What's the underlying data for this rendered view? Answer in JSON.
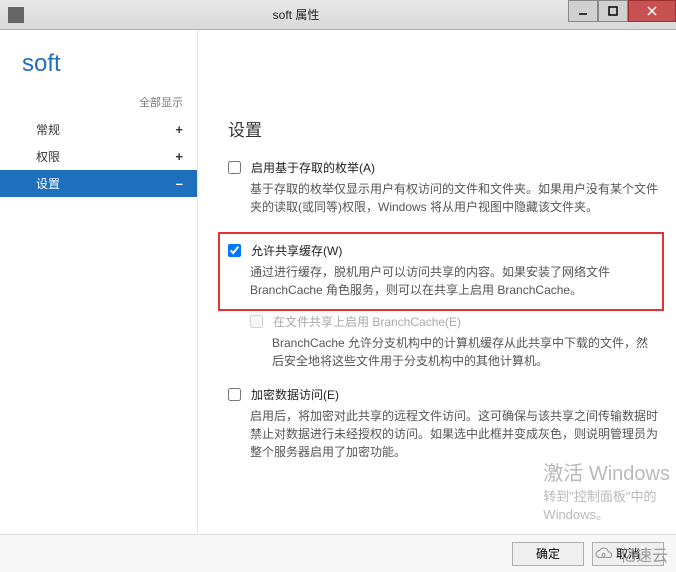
{
  "titlebar": {
    "title": "soft 属性"
  },
  "sidebar": {
    "app_title": "soft",
    "show_all": "全部显示",
    "items": [
      {
        "label": "常规",
        "symbol": "+"
      },
      {
        "label": "权限",
        "symbol": "+"
      },
      {
        "label": "设置",
        "symbol": "–"
      }
    ]
  },
  "content": {
    "section_title": "设置",
    "settings": [
      {
        "label": "启用基于存取的枚举(A)",
        "desc": "基于存取的枚举仅显示用户有权访问的文件和文件夹。如果用户没有某个文件夹的读取(或同等)权限，Windows 将从用户视图中隐藏该文件夹。"
      },
      {
        "label": "允许共享缓存(W)",
        "desc": "通过进行缓存，脱机用户可以访问共享的内容。如果安装了网络文件 BranchCache 角色服务，则可以在共享上启用 BranchCache。"
      },
      {
        "label": "在文件共享上启用 BranchCache(E)",
        "desc": "BranchCache 允许分支机构中的计算机缓存从此共享中下载的文件，然后安全地将这些文件用于分支机构中的其他计算机。"
      },
      {
        "label": "加密数据访问(E)",
        "desc": "启用后，将加密对此共享的远程文件访问。这可确保与该共享之间传输数据时禁止对数据进行未经授权的访问。如果选中此框并变成灰色，则说明管理员为整个服务器启用了加密功能。"
      }
    ]
  },
  "footer": {
    "ok": "确定",
    "cancel": "取消"
  },
  "watermark": {
    "line1": "激活 Windows",
    "line2": "转到\"控制面板\"中的",
    "line3": "Windows。"
  },
  "logo": "亿速云"
}
